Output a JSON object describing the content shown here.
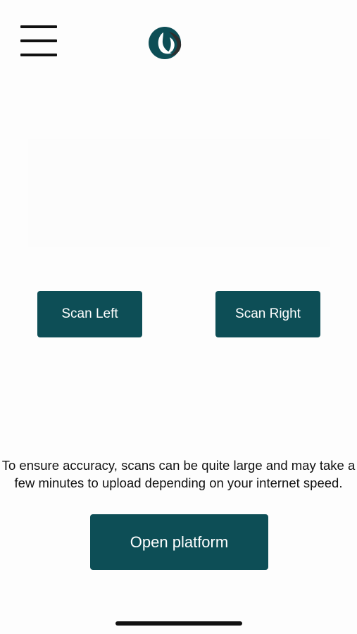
{
  "header": {
    "menu_icon": "hamburger-menu-icon",
    "logo_icon": "leaf-circle-logo"
  },
  "scan": {
    "left_label": "Scan Left",
    "right_label": "Scan Right"
  },
  "info": {
    "text": "To ensure accuracy, scans can be quite large and may take a few minutes to upload depending on your internet speed."
  },
  "actions": {
    "open_platform_label": "Open platform"
  },
  "colors": {
    "brand": "#0d4e56",
    "button_text": "#ffffff",
    "background": "#fdfdfd",
    "text": "#111111"
  }
}
